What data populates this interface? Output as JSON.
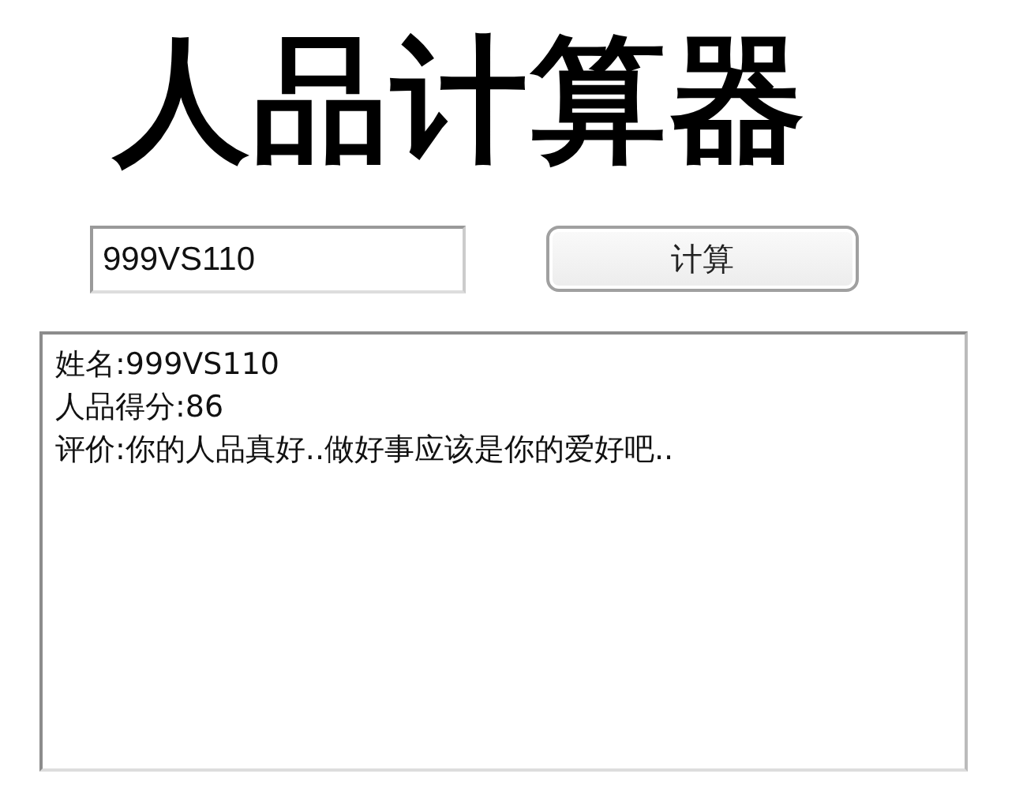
{
  "title": "人品计算器",
  "name_field": {
    "value": "999VS110"
  },
  "calculate_button": {
    "label": "计算"
  },
  "result": {
    "lines": [
      "姓名:999VS110",
      "人品得分:86",
      "评价:你的人品真好..做好事应该是你的爱好吧.."
    ]
  }
}
